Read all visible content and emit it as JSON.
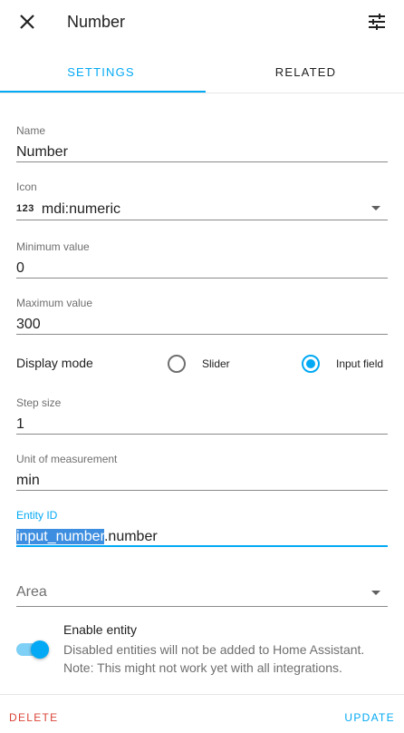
{
  "header": {
    "title": "Number",
    "close_icon": "close-icon",
    "settings_icon": "tune-icon"
  },
  "tabs": [
    {
      "label": "SETTINGS",
      "active": true
    },
    {
      "label": "RELATED",
      "active": false
    }
  ],
  "fields": {
    "name": {
      "label": "Name",
      "value": "Number"
    },
    "icon": {
      "label": "Icon",
      "glyph": "123",
      "value": "mdi:numeric"
    },
    "min": {
      "label": "Minimum value",
      "value": "0"
    },
    "max": {
      "label": "Maximum value",
      "value": "300"
    },
    "display_mode": {
      "label": "Display mode",
      "options": [
        "Slider",
        "Input field"
      ],
      "selected": "Input field"
    },
    "step": {
      "label": "Step size",
      "value": "1"
    },
    "unit": {
      "label": "Unit of measurement",
      "value": "min"
    },
    "entity_id": {
      "label": "Entity ID",
      "selected_part": "input_number",
      "rest": ".number"
    },
    "area": {
      "label": "Area"
    }
  },
  "enable": {
    "title": "Enable entity",
    "description": "Disabled entities will not be added to Home Assistant. Note: This might not work yet with all integrations.",
    "on": true
  },
  "footer": {
    "delete_label": "DELETE",
    "update_label": "UPDATE"
  },
  "colors": {
    "accent": "#03a9f4",
    "danger": "#db4437",
    "text": "#212121",
    "muted": "#6f6f6f"
  }
}
